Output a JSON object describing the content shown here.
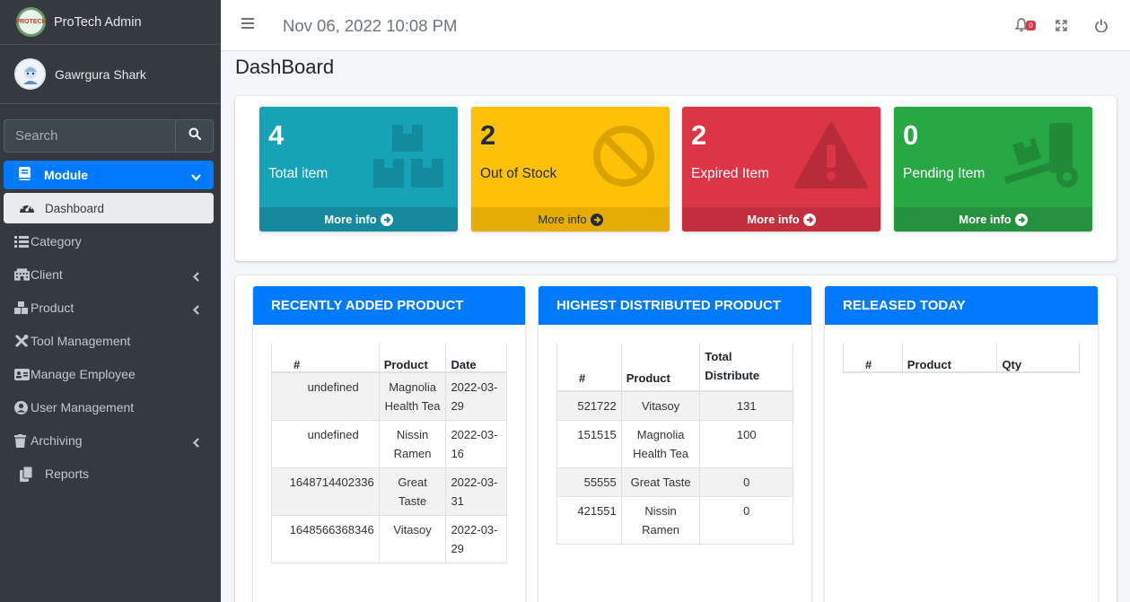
{
  "brand": {
    "name": "ProTech Admin",
    "logo_text": "PROTECH"
  },
  "user": {
    "name": "Gawrgura Shark"
  },
  "search": {
    "placeholder": "Search"
  },
  "sidebar": {
    "module_label": "Module",
    "dashboard_label": "Dashboard",
    "items": [
      {
        "label": "Category",
        "icon": "list-icon"
      },
      {
        "label": "Client",
        "icon": "building-icon"
      },
      {
        "label": "Product",
        "icon": "boxes-icon"
      },
      {
        "label": "Tool Management",
        "icon": "tools-icon"
      },
      {
        "label": "Manage Employee",
        "icon": "id-card-icon"
      },
      {
        "label": "User Management",
        "icon": "user-circle-icon"
      },
      {
        "label": "Archiving",
        "icon": "trash-icon"
      },
      {
        "label": "Reports",
        "icon": "copy-icon"
      }
    ]
  },
  "topbar": {
    "datetime": "Nov 06, 2022 10:08 PM",
    "notification_count": "0"
  },
  "page": {
    "title": "DashBoard"
  },
  "boxes": [
    {
      "value": "4",
      "label": "Total item",
      "link": "More info",
      "color": "#17a2b8"
    },
    {
      "value": "2",
      "label": "Out of Stock",
      "link": "More info",
      "color": "#ffc107"
    },
    {
      "value": "2",
      "label": "Expired Item",
      "link": "More info",
      "color": "#dc3545"
    },
    {
      "value": "0",
      "label": "Pending Item",
      "link": "More info",
      "color": "#28a745"
    }
  ],
  "recent": {
    "title": "RECENTLY ADDED PRODUCT",
    "headers": [
      "#",
      "Product",
      "Date"
    ],
    "rows": [
      [
        "undefined",
        "Magnolia Health Tea",
        "2022-03-29"
      ],
      [
        "undefined",
        "Nissin Ramen",
        "2022-03-16"
      ],
      [
        "1648714402336",
        "Great Taste",
        "2022-03-31"
      ],
      [
        "1648566368346",
        "Vitasoy",
        "2022-03-29"
      ]
    ]
  },
  "distributed": {
    "title": "HIGHEST DISTRIBUTED PRODUCT",
    "headers": [
      "#",
      "Product",
      "Total Distribute"
    ],
    "rows": [
      [
        "521722",
        "Vitasoy",
        "131"
      ],
      [
        "151515",
        "Magnolia Health Tea",
        "100"
      ],
      [
        "55555",
        "Great Taste",
        "0"
      ],
      [
        "421551",
        "Nissin Ramen",
        "0"
      ]
    ]
  },
  "released": {
    "title": "RELEASED TODAY",
    "headers": [
      "#",
      "Product",
      "Qty"
    ]
  },
  "colors": {
    "primary": "#007bff",
    "sidebar": "#343a40"
  }
}
